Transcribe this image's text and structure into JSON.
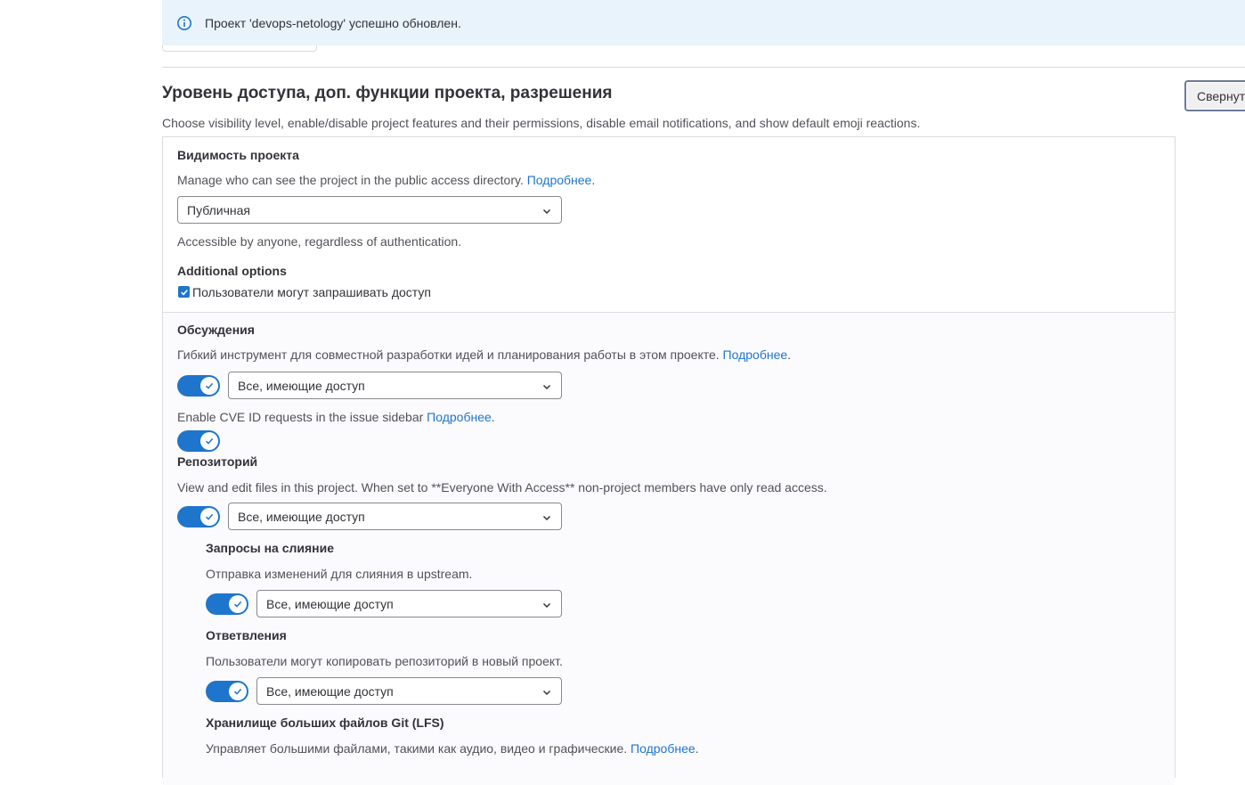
{
  "flash": {
    "icon": "info-icon",
    "message": "Проект 'devops-netology' успешно обновлен."
  },
  "section": {
    "title": "Уровень доступа, доп. функции проекта, разрешения",
    "description": "Choose visibility level, enable/disable project features and their permissions, disable email notifications, and show default emoji reactions.",
    "collapse_label": "Свернут"
  },
  "visibility": {
    "label": "Видимость проекта",
    "help": "Manage who can see the project in the public access directory.",
    "help_link": "Подробнее",
    "select_value": "Публичная",
    "note": "Accessible by anyone, regardless of authentication."
  },
  "additional": {
    "label": "Additional options",
    "request_access_label": "Пользователи могут запрашивать доступ",
    "request_access_checked": true
  },
  "issues": {
    "label": "Обсуждения",
    "help": "Гибкий инструмент для совместной разработки идей и планирования работы в этом проекте.",
    "help_link": "Подробнее",
    "enabled": true,
    "select_value": "Все, имеющие доступ",
    "cve_help": "Enable CVE ID requests in the issue sidebar",
    "cve_link": "Подробнее",
    "cve_enabled": true
  },
  "repository": {
    "label": "Репозиторий",
    "help": "View and edit files in this project. When set to **Everyone With Access** non-project members have only read access.",
    "enabled": true,
    "select_value": "Все, имеющие доступ"
  },
  "merge_requests": {
    "label": "Запросы на слияние",
    "help": "Отправка изменений для слияния в upstream.",
    "enabled": true,
    "select_value": "Все, имеющие доступ"
  },
  "forks": {
    "label": "Ответвления",
    "help": "Пользователи могут копировать репозиторий в новый проект.",
    "enabled": true,
    "select_value": "Все, имеющие доступ"
  },
  "lfs": {
    "label": "Хранилище больших файлов Git (LFS)",
    "help": "Управляет большими файлами, такими как аудио, видео и графические.",
    "help_link": "Подробнее"
  },
  "colors": {
    "accent": "#1f75cb",
    "flash_bg": "#e9f3fc",
    "border": "#dcdcde"
  }
}
